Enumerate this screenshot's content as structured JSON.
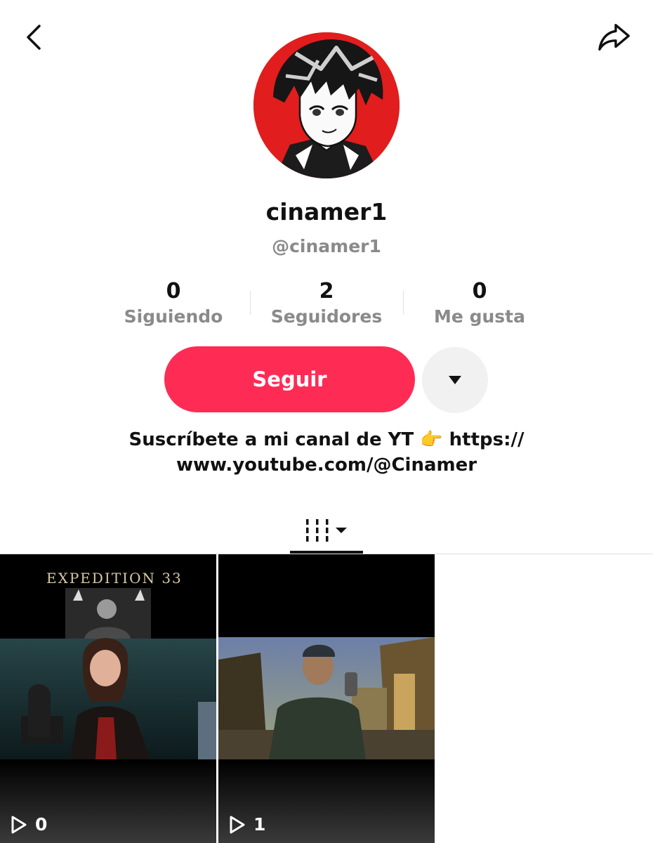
{
  "profile": {
    "display_name": "cinamer1",
    "username": "@cinamer1"
  },
  "stats": [
    {
      "value": "0",
      "label": "Siguiendo"
    },
    {
      "value": "2",
      "label": "Seguidores"
    },
    {
      "value": "0",
      "label": "Me gusta"
    }
  ],
  "actions": {
    "follow_label": "Seguir"
  },
  "bio": {
    "line1": "Suscríbete a mi canal de YT 👉 https://",
    "line2": "www.youtube.com/@Cinamer"
  },
  "videos": [
    {
      "thumb_title": "EXPEDITION 33",
      "plays": "0"
    },
    {
      "plays": "1"
    }
  ],
  "colors": {
    "accent": "#fe2c55",
    "secondary_text": "#8a8a8a"
  },
  "icons": {
    "back": "chevron-left-icon",
    "share": "share-arrow-icon",
    "more": "caret-down-icon",
    "grid": "grid-icon",
    "play": "play-icon"
  }
}
